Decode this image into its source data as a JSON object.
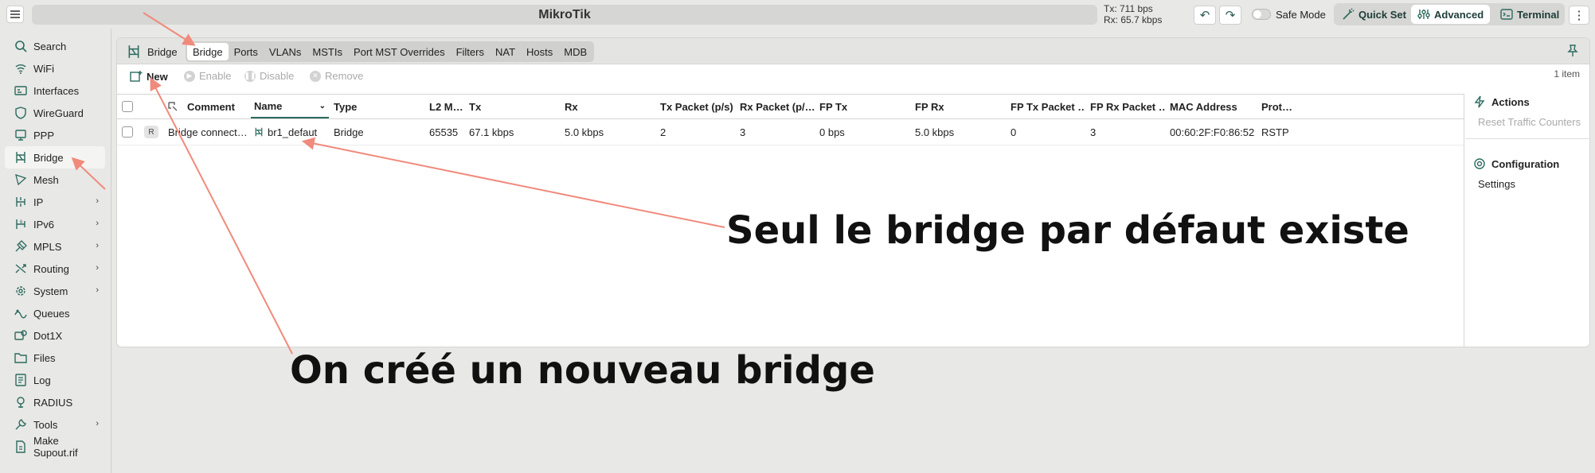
{
  "app": {
    "title": "MikroTik",
    "traffic_tx": "Tx: 711 bps",
    "traffic_rx": "Rx: 65.7 kbps",
    "safe_mode_label": "Safe Mode",
    "modes": [
      "Quick Set",
      "Advanced",
      "Terminal"
    ],
    "active_mode": "Advanced"
  },
  "sidebar": {
    "items": [
      {
        "label": "Search",
        "icon": "search-icon"
      },
      {
        "label": "WiFi",
        "icon": "wifi-icon"
      },
      {
        "label": "Interfaces",
        "icon": "interfaces-icon"
      },
      {
        "label": "WireGuard",
        "icon": "shield-icon"
      },
      {
        "label": "PPP",
        "icon": "ppp-icon"
      },
      {
        "label": "Bridge",
        "icon": "bridge-icon"
      },
      {
        "label": "Mesh",
        "icon": "mesh-icon"
      },
      {
        "label": "IP",
        "icon": "ip-icon"
      },
      {
        "label": "IPv6",
        "icon": "ipv6-icon"
      },
      {
        "label": "MPLS",
        "icon": "mpls-icon"
      },
      {
        "label": "Routing",
        "icon": "routing-icon"
      },
      {
        "label": "System",
        "icon": "gear-icon"
      },
      {
        "label": "Queues",
        "icon": "queues-icon"
      },
      {
        "label": "Dot1X",
        "icon": "dot1x-icon"
      },
      {
        "label": "Files",
        "icon": "folder-icon"
      },
      {
        "label": "Log",
        "icon": "log-icon"
      },
      {
        "label": "RADIUS",
        "icon": "radius-icon"
      },
      {
        "label": "Tools",
        "icon": "tools-icon"
      },
      {
        "label": "Make Supout.rif",
        "icon": "supout-icon"
      }
    ],
    "active": "Bridge"
  },
  "panel": {
    "heading": "Bridge",
    "tabs": [
      "Bridge",
      "Ports",
      "VLANs",
      "MSTIs",
      "Port MST Overrides",
      "Filters",
      "NAT",
      "Hosts",
      "MDB"
    ],
    "active_tab": "Bridge",
    "actions": {
      "new": "New",
      "enable": "Enable",
      "disable": "Disable",
      "remove": "Remove"
    },
    "item_count": "1 item"
  },
  "table": {
    "columns": [
      "Comment",
      "Name",
      "Type",
      "L2 M…",
      "Tx",
      "Rx",
      "Tx Packet (p/s)",
      "Rx Packet (p/…",
      "FP Tx",
      "FP Rx",
      "FP Tx Packet …",
      "FP Rx Packet …",
      "MAC Address",
      "Prot…"
    ],
    "rows": [
      {
        "flag": "R",
        "comment": "Bridge connect…",
        "name": "br1_defaut",
        "type": "Bridge",
        "l2mtu": "65535",
        "tx": "67.1 kbps",
        "rx": "5.0 kbps",
        "tx_packet": "2",
        "rx_packet": "3",
        "fp_tx": "0 bps",
        "fp_rx": "5.0 kbps",
        "fp_tx_packet": "0",
        "fp_rx_packet": "3",
        "mac": "00:60:2F:F0:86:52",
        "protocol": "RSTP"
      }
    ]
  },
  "right_panel": {
    "actions_title": "Actions",
    "reset_counters": "Reset Traffic Counters",
    "configuration_title": "Configuration",
    "settings": "Settings"
  },
  "annotations": {
    "default_bridge": "Seul le bridge par défaut existe",
    "new_bridge": "On créé un nouveau bridge",
    "color": "#f08a7c"
  }
}
